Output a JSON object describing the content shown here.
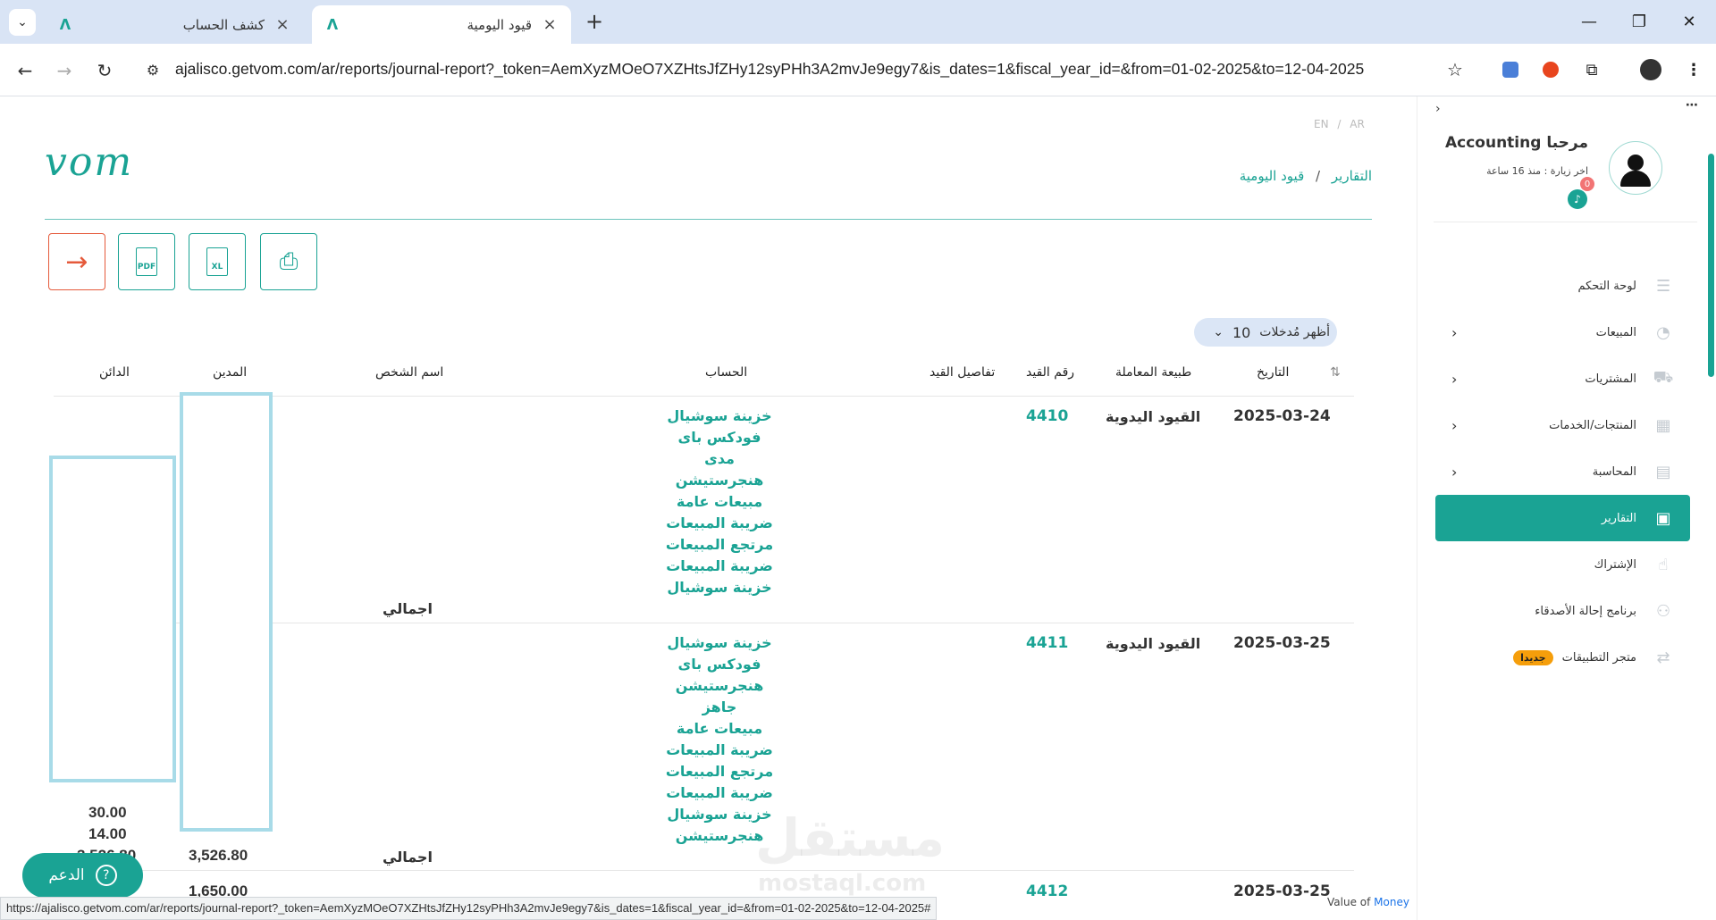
{
  "browser": {
    "tabs": [
      {
        "title": "كشف الحساب",
        "active": false
      },
      {
        "title": "قيود اليومية",
        "active": true
      }
    ],
    "url": "ajalisco.getvom.com/ar/reports/journal-report?_token=AemXyzMOeO7XZHtsJfZHy12syPHh3A2mvJe9egy7&is_dates=1&fiscal_year_id=&from=01-02-2025&to=12-04-2025",
    "status_url": "https://ajalisco.getvom.com/ar/reports/journal-report?_token=AemXyzMOeO7XZHtsJfZHy12syPHh3A2mvJe9egy7&is_dates=1&fiscal_year_id=&from=01-02-2025&to=12-04-2025#"
  },
  "header": {
    "logo_text": "vom",
    "lang_en": "EN",
    "lang_sep": "/",
    "lang_ar": "AR",
    "breadcrumb_parent": "التقارير",
    "breadcrumb_sep": "/",
    "breadcrumb_current": "قيود اليومية"
  },
  "actions": {
    "pdf_label": "PDF",
    "xl_label": "XL"
  },
  "table": {
    "show_entries_label": "أظهر مُدخلات",
    "show_entries_value": "10",
    "columns": {
      "date": "التاريخ",
      "type": "طبيعة المعاملة",
      "entry_no": "رقم القيد",
      "details": "تفاصيل القيد",
      "account": "الحساب",
      "person": "اسم الشخص",
      "debit": "المدين",
      "credit": "الدائن"
    },
    "rows": [
      {
        "date": "2025-03-24",
        "type": "القيود اليدوية",
        "entry_no": "4410",
        "accounts": [
          "خزينة سوشيال",
          "فودكس باى",
          "مدى",
          "هنجرستيشن",
          "مبيعات عامة",
          "ضريبة المبيعات",
          "مرتجع المبيعات",
          "ضريبة المبيعات",
          "خزينة سوشيال"
        ],
        "total_label": "اجمالي"
      },
      {
        "date": "2025-03-25",
        "type": "القيود اليدوية",
        "entry_no": "4411",
        "accounts": [
          "خزينة سوشيال",
          "فودكس باى",
          "هنجرستيشن",
          "جاهز",
          "مبيعات عامة",
          "ضريبة المبيعات",
          "مرتجع المبيعات",
          "ضريبة المبيعات",
          "خزينة سوشيال",
          "هنجرستيشن"
        ],
        "total_label": "اجمالي",
        "credit_values": [
          "30.00",
          "14.00",
          "3,526.80"
        ],
        "debit_total": "3,526.80"
      },
      {
        "date": "2025-03-25",
        "entry_no": "4412",
        "debit_partial": "1,650.00"
      }
    ]
  },
  "support": {
    "label": "الدعم",
    "icon_text": "?"
  },
  "watermark": {
    "text": "مستقل",
    "sub": "mostaql.com"
  },
  "sidebar": {
    "welcome": "مرحبا Accounting",
    "last_visit": "اخر زيارة : منذ 16 ساعة",
    "notifications": "0",
    "menu": [
      {
        "label": "لوحة التحكم",
        "icon": "dashboard-icon",
        "chevron": false
      },
      {
        "label": "المبيعات",
        "icon": "sales-icon",
        "chevron": true
      },
      {
        "label": "المشتريات",
        "icon": "cart-icon",
        "chevron": true
      },
      {
        "label": "المنتجات/الخدمات",
        "icon": "products-icon",
        "chevron": true
      },
      {
        "label": "المحاسبة",
        "icon": "calculator-icon",
        "chevron": true
      },
      {
        "label": "التقارير",
        "icon": "report-icon",
        "chevron": false,
        "active": true
      },
      {
        "label": "الإشتراك",
        "icon": "hand-icon",
        "chevron": false
      },
      {
        "label": "برنامج إحالة الأصدقاء",
        "icon": "referral-icon",
        "chevron": false
      },
      {
        "label": "متجر التطبيقات",
        "icon": "transfer-icon",
        "chevron": false,
        "badge": "جديدا"
      }
    ]
  },
  "footer": {
    "value_of": "Value of",
    "brand": "Money"
  },
  "colors": {
    "brand": "#1aa394",
    "exit": "#e55a3b",
    "badge": "#f59e0b"
  }
}
